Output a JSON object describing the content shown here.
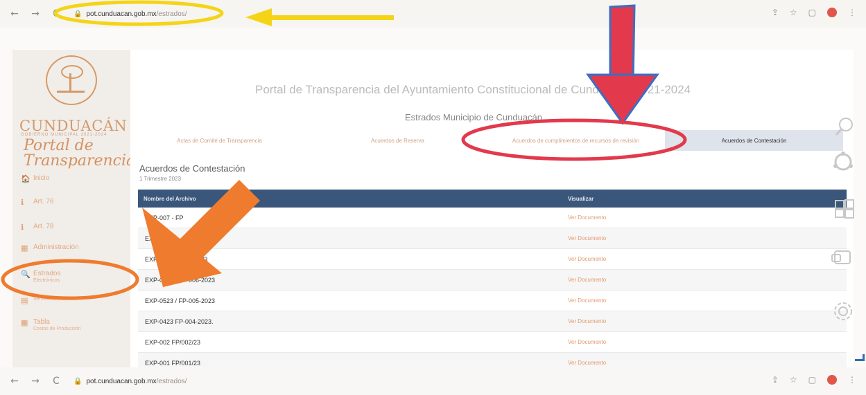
{
  "browser": {
    "nav": {
      "back": "←",
      "forward": "→",
      "reload": "C"
    },
    "lock": "🔒",
    "url_domain": "pot.cunduacan.gob.mx",
    "url_path": "/estrados/",
    "icons": [
      "share-icon",
      "star-icon",
      "sidebar-icon",
      "profile-icon",
      "menu-icon"
    ],
    "icon_glyphs": {
      "share": "⇪",
      "star": "☆",
      "sidebar": "▢",
      "menu": "⋮"
    },
    "profile_color": "#e2554a"
  },
  "sidebar": {
    "brand": "CUNDUACÁN",
    "brand_sub": "GOBIERNO MUNICIPAL 2021-2024",
    "portal_line1": "Portal de",
    "portal_line2": "Transparencia",
    "items": [
      {
        "icon": "🏠",
        "label": "Inicio",
        "sub": ""
      },
      {
        "icon": "ℹ",
        "label": "Art. 76",
        "sub": ""
      },
      {
        "icon": "ℹ",
        "label": "Art. 78",
        "sub": ""
      },
      {
        "icon": "▦",
        "label": "Administración",
        "sub": ""
      },
      {
        "icon": "🔍",
        "label": "Estrados",
        "sub": "Electrónicos"
      },
      {
        "icon": "▤",
        "label": "",
        "sub": "Servidores Públicos"
      },
      {
        "icon": "▦",
        "label": "Tabla",
        "sub": "Costos de Producción"
      }
    ]
  },
  "main": {
    "header": "Portal de Transparencia del Ayuntamiento Constitucional de Cunduacán 2021-2024",
    "subheader": "Estrados Municipio de Cunduacán",
    "tabs": [
      {
        "label": "Actas de Comité de Transparencia",
        "active": false
      },
      {
        "label": "Acuerdos de Reserva",
        "active": false
      },
      {
        "label": "Acuerdos de cumplimientos de recursos de revisión",
        "active": false
      },
      {
        "label": "Acuerdos de Contestación",
        "active": true
      }
    ],
    "section_title": "Acuerdos de Contestación",
    "section_sub": "1 Trimestre 2023",
    "table": {
      "headers": [
        "Nombre del Archivo",
        "Visualizar"
      ],
      "rows": [
        {
          "name": "EXP-007 - FP",
          "link": "Ver Documento"
        },
        {
          "name": "EXP",
          "link": "Ver Documento"
        },
        {
          "name": "EXP-0823 / FP-003/23",
          "link": "Ver Documento"
        },
        {
          "name": "EXP-0623 / FP-006-2023",
          "link": "Ver Documento"
        },
        {
          "name": "EXP-0523 / FP-005-2023",
          "link": "Ver Documento"
        },
        {
          "name": "EXP-0423 FP-004-2023.",
          "link": "Ver Documento"
        },
        {
          "name": "EXP-002 FP/002/23",
          "link": "Ver Documento"
        },
        {
          "name": "EXP-001 FP/001/23",
          "link": "Ver Documento"
        }
      ]
    }
  },
  "floating_icons": [
    "search-icon",
    "ubuntu-icon",
    "windows-icon",
    "device-icon",
    "settings-icon"
  ],
  "annotation_colors": {
    "yellow": "#f5d418",
    "red": "#e2394c",
    "orange": "#ef7b2e"
  }
}
